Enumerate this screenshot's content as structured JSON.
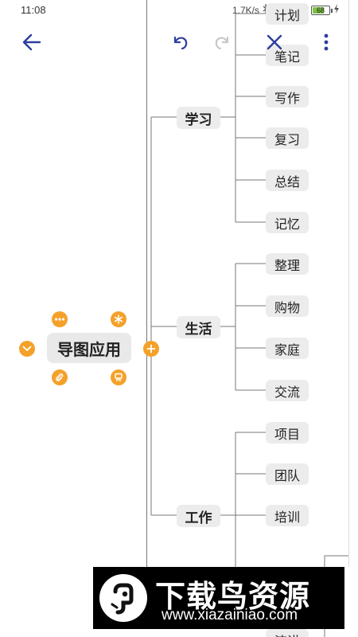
{
  "status_bar": {
    "time": "11:08",
    "network_speed": "1.7K/s",
    "battery_level": "68",
    "battery_fraction": 0.68
  },
  "toolbar": {
    "back_icon": "arrow-left-icon",
    "undo_icon": "undo-icon",
    "redo_icon": "redo-icon",
    "close_icon": "close-icon",
    "more_icon": "more-vertical-icon",
    "accent_color": "#2e3d9e",
    "disabled_color": "#c8c8c8"
  },
  "mindmap": {
    "root": {
      "label": "导图应用"
    },
    "branches": [
      {
        "label": "学习",
        "children": [
          "计划",
          "笔记",
          "写作",
          "复习",
          "总结",
          "记忆"
        ]
      },
      {
        "label": "生活",
        "children": [
          "整理",
          "购物",
          "家庭",
          "交流"
        ]
      },
      {
        "label": "工作",
        "children": [
          "项目",
          "团队",
          "培训",
          "",
          "",
          "流讲"
        ]
      }
    ],
    "node_actions": [
      "more-icon",
      "asterisk-icon",
      "collapse-icon",
      "add-icon",
      "attachment-icon",
      "flag-icon"
    ],
    "accent_color": "#f4a12a"
  },
  "watermark": {
    "title": "下载鸟资源",
    "url": "www.xiazainiao.com"
  }
}
